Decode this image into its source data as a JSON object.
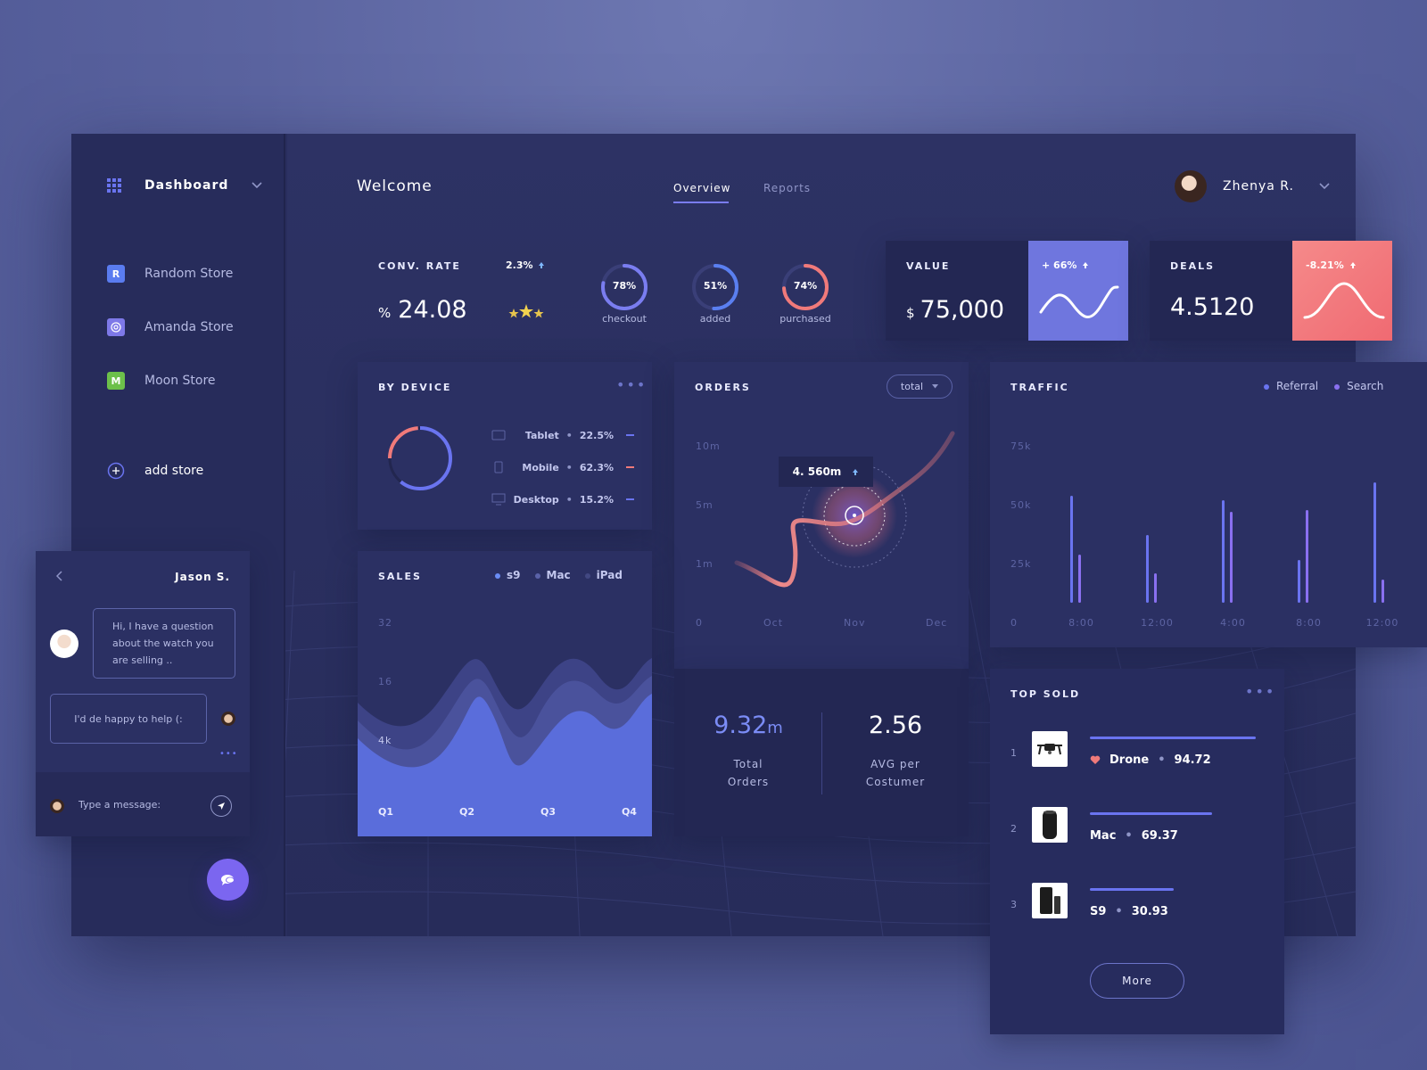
{
  "sidebar": {
    "title": "Dashboard",
    "stores": [
      {
        "label": "Random Store",
        "letter": "R",
        "color": "#5a7cf0"
      },
      {
        "label": "Amanda Store",
        "letter": "",
        "color": "#7e79e8"
      },
      {
        "label": "Moon Store",
        "letter": "M",
        "color": "#6cc04a"
      }
    ],
    "add_store": "add store"
  },
  "header": {
    "welcome": "Welcome",
    "tabs": [
      "Overview",
      "Reports"
    ],
    "user": "Zhenya R."
  },
  "stats": {
    "conv_rate_label": "CONV. RATE",
    "conv_rate_prefix": "%",
    "conv_rate_value": "24.08",
    "conv_change": "2.3%",
    "rings": [
      {
        "pct": "78%",
        "label": "checkout",
        "value": 0.78,
        "color": "#7a7df0"
      },
      {
        "pct": "51%",
        "label": "added",
        "value": 0.51,
        "color": "#5a7ff0"
      },
      {
        "pct": "74%",
        "label": "purchased",
        "value": 0.74,
        "color": "#f07a7a"
      }
    ],
    "value_label": "VALUE",
    "value_prefix": "$",
    "value_amount": "75,000",
    "value_change": "+ 66%",
    "deals_label": "DEALS",
    "deals_amount": "4.5120",
    "deals_change": "-8.21%"
  },
  "by_device": {
    "title": "BY DEVICE",
    "items": [
      {
        "name": "Tablet",
        "pct": "22.5%",
        "color": "#6a74f0"
      },
      {
        "name": "Mobile",
        "pct": "62.3%",
        "color": "#f07a7a"
      },
      {
        "name": "Desktop",
        "pct": "15.2%",
        "color": "#6a74f0"
      }
    ]
  },
  "orders": {
    "title": "ORDERS",
    "filter": "total",
    "tooltip": "4. 560m",
    "y_ticks": [
      "10m",
      "5m",
      "1m",
      "0"
    ],
    "x_ticks": [
      "Oct",
      "Nov",
      "Dec"
    ],
    "total_value": "9.32",
    "total_unit": "m",
    "total_label_1": "Total",
    "total_label_2": "Orders",
    "avg_value": "2.56",
    "avg_label_1": "AVG per",
    "avg_label_2": "Costumer"
  },
  "traffic": {
    "title": "TRAFFIC",
    "legend": [
      "Referral",
      "Search"
    ],
    "y_ticks": [
      "75k",
      "50k",
      "25k",
      "0"
    ],
    "x_ticks": [
      "8:00",
      "12:00",
      "4:00",
      "8:00",
      "12:00"
    ],
    "bars": [
      {
        "referral": 55,
        "search": 25
      },
      {
        "referral": 35,
        "search": 15
      },
      {
        "referral": 53,
        "search": 47
      },
      {
        "referral": 22,
        "search": 48
      },
      {
        "referral": 62,
        "search": 12
      }
    ],
    "ymax": 80
  },
  "sales": {
    "title": "SALES",
    "legend": [
      "s9",
      "Mac",
      "iPad"
    ],
    "y_ticks": [
      "32",
      "16",
      "4k"
    ],
    "x_ticks": [
      "Q1",
      "Q2",
      "Q3",
      "Q4"
    ]
  },
  "top_sold": {
    "title": "TOP SOLD",
    "items": [
      {
        "rank": "1",
        "name": "Drone",
        "value": "94.72",
        "progress": 0.95
      },
      {
        "rank": "2",
        "name": "Mac",
        "value": "69.37",
        "progress": 0.7
      },
      {
        "rank": "3",
        "name": "S9",
        "value": "30.93",
        "progress": 0.48
      }
    ],
    "more": "More"
  },
  "chat": {
    "name": "Jason S.",
    "incoming": "Hi, I have a question about the watch you are selling ..",
    "outgoing": "I'd de happy to help (:",
    "placeholder": "Type a message:"
  }
}
